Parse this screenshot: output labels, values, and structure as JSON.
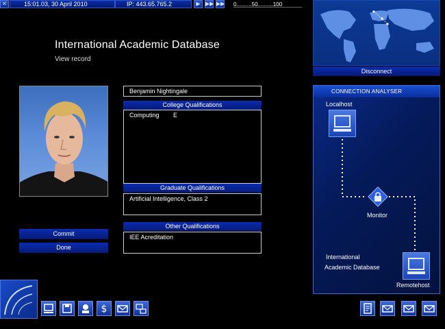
{
  "topbar": {
    "datetime": "15:01.03, 30 April 2010",
    "ip": "IP: 443.65.765.2",
    "speed_scale": "0..........50..........100"
  },
  "page": {
    "title": "International Academic Database",
    "subtitle": "View record"
  },
  "record": {
    "name": "Benjamin Nightingale",
    "college_header": "College Qualifications",
    "college_subject": "Computing",
    "college_grade": "E",
    "graduate_header": "Graduate Qualifications",
    "graduate_value": "Artificial Intelligence, Class 2",
    "other_header": "Other Qualifications",
    "other_value": "IEE Acreditation"
  },
  "actions": {
    "commit": "Commit",
    "done": "Done",
    "disconnect": "Disconnect"
  },
  "analyser": {
    "title": "CONNECTION ANALYSER",
    "localhost": "Localhost",
    "monitor": "Monitor",
    "remote_line1": "International",
    "remote_line2": "Academic Database",
    "remotehost": "Remotehost"
  },
  "icons": {
    "top_buttons": [
      "close-icon",
      "play-icon",
      "fast-forward-icon",
      "skip-icon"
    ],
    "bottom_left": [
      "uplink-logo-icon",
      "computer-icon",
      "disk-icon",
      "gateway-icon",
      "finance-icon",
      "email-icon",
      "hardware-icon"
    ],
    "bottom_right": [
      "document-icon",
      "mail-icon",
      "mail-icon",
      "mail-icon"
    ]
  },
  "colors": {
    "panel_blue": "#0b2cb0",
    "background": "#000000"
  }
}
